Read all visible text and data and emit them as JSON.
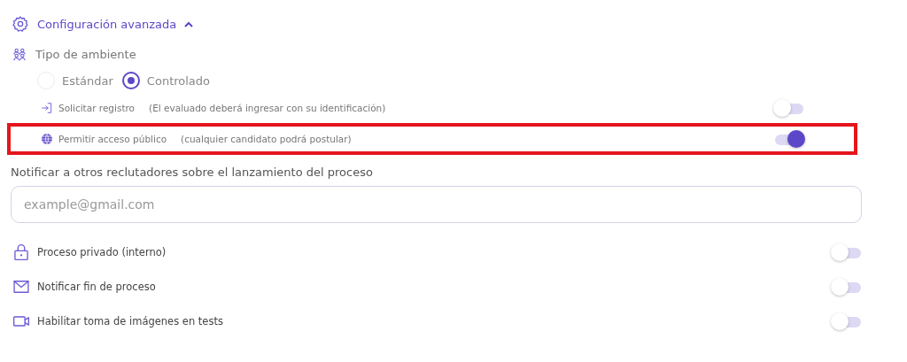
{
  "header": {
    "title": "Configuración avanzada",
    "expanded": true
  },
  "environment": {
    "label": "Tipo de ambiente",
    "options": [
      {
        "label": "Estándar",
        "selected": false
      },
      {
        "label": "Controlado",
        "selected": true
      }
    ]
  },
  "access_options": [
    {
      "label": "Solicitar registro",
      "hint": "(El evaluado deberá ingresar con su identificación)",
      "on": false,
      "highlighted": false
    },
    {
      "label": "Permitir acceso público",
      "hint": "(cualquier candidato podrá postular)",
      "on": true,
      "highlighted": true
    }
  ],
  "notify": {
    "label": "Notificar a otros reclutadores sobre el lanzamiento del proceso",
    "placeholder": "example@gmail.com"
  },
  "settings": [
    {
      "label": "Proceso privado (interno)",
      "on": false
    },
    {
      "label": "Notificar fin de proceso",
      "on": false
    },
    {
      "label": "Habilitar toma de imágenes en tests",
      "on": false
    }
  ]
}
